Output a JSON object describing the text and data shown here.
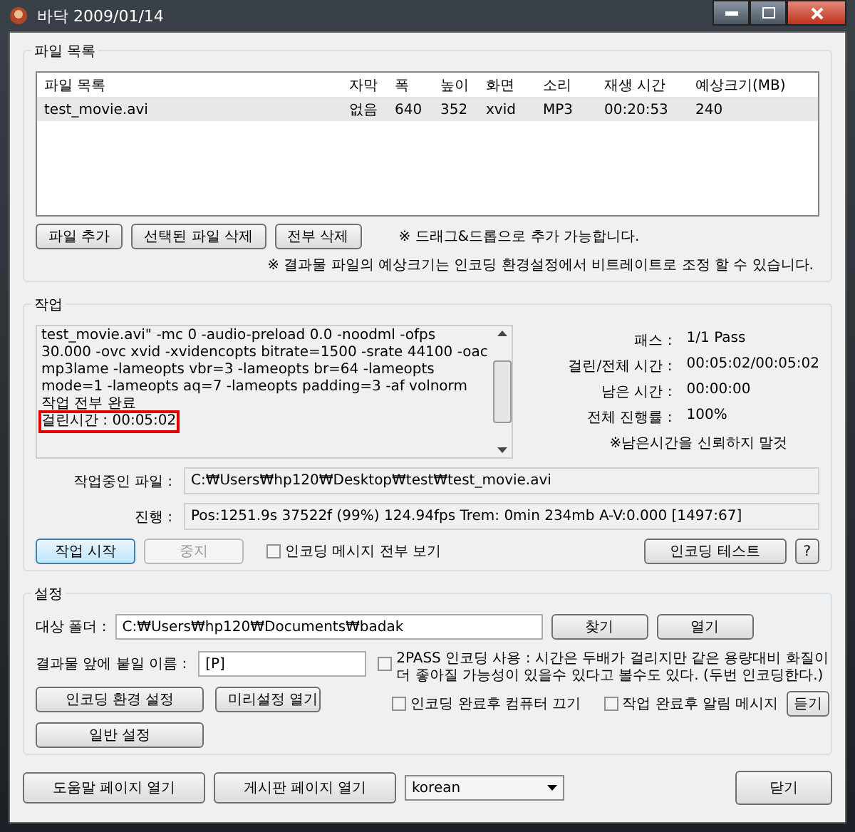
{
  "window": {
    "title": "바닥 2009/01/14"
  },
  "file_list": {
    "title": "파일 목록",
    "columns": [
      "파일 목록",
      "자막",
      "폭",
      "높이",
      "화면",
      "소리",
      "재생 시간",
      "예상크기(MB)"
    ],
    "rows": [
      {
        "selected": true,
        "cells": [
          "test_movie.avi",
          "없음",
          "640",
          "352",
          "xvid",
          "MP3",
          "00:20:53",
          "240"
        ]
      }
    ],
    "buttons": [
      {
        "label": "파일 추가",
        "disabled": false
      },
      {
        "label": "선택된 파일 삭제",
        "disabled": false
      },
      {
        "label": "전부 삭제",
        "disabled": false
      }
    ],
    "notes": [
      "※ 드래그&드롭으로 추가 가능합니다.",
      "※ 결과물 파일의 예상크기는 인코딩 환경설정에서 비트레이트로 조정 할 수 있습니다."
    ]
  },
  "job": {
    "title": "작업",
    "log": [
      {
        "text": "test_movie.avi\" -mc 0 -audio-preload 0.0 -noodml -ofps 30.000 -ovc xvid -xvidencopts bitrate=1500 -srate 44100 -oac mp3lame -lameopts vbr=3  -lameopts br=64 -lameopts mode=1 -lameopts aq=7 -lameopts padding=3 -af volnorm",
        "highlighted": false
      },
      {
        "text": "작업 전부 완료",
        "highlighted": false
      },
      {
        "text": "걸린시간 : 00:05:02",
        "highlighted": true
      }
    ],
    "stats": [
      {
        "label": "패스 :",
        "value": "1/1 Pass"
      },
      {
        "label": "걸린/전체 시간 :",
        "value": "00:05:02/00:05:02"
      },
      {
        "label": "남은 시간 :",
        "value": "00:00:00"
      },
      {
        "label": "전체 진행률 :",
        "value": "100%"
      }
    ],
    "stats_note": "※남은시간을 신뢰하지 말것",
    "current_file": {
      "label": "작업중인 파일 :",
      "value": "C:₩Users₩hp120₩Desktop₩test₩test_movie.avi"
    },
    "progress": {
      "label": "진행 :",
      "value": "Pos:1251.9s  37522f (99%) 124.94fps Trem:   0min 234mb  A-V:0.000 [1497:67]"
    },
    "buttons": [
      {
        "label": "작업 시작",
        "disabled": false,
        "focused": true
      },
      {
        "label": "중지",
        "disabled": true,
        "focused": false
      }
    ],
    "show_all_messages": {
      "label": "인코딩 메시지 전부 보기",
      "checked": false
    },
    "test_buttons": [
      {
        "label": "인코딩 테스트",
        "disabled": false
      },
      {
        "label": "?",
        "disabled": false
      }
    ]
  },
  "settings": {
    "title": "설정",
    "target_folder": {
      "label": "대상 폴더 :",
      "value": "C:₩Users₩hp120₩Documents₩badak"
    },
    "folder_buttons": [
      {
        "label": "찾기"
      },
      {
        "label": "열기"
      }
    ],
    "prefix": {
      "label": "결과물 앞에 붙일 이름 :",
      "value": "[P]"
    },
    "two_pass": {
      "label": "2PASS 인코딩 사용 : 시간은 두배가 걸리지만 같은 용량대비 화질이 더 좋아질 가능성이 있을수 있다고 볼수도 있다. (두번 인코딩한다.)",
      "checked": false
    },
    "buttons": [
      {
        "label": "인코딩 환경 설정"
      },
      {
        "label": "미리설정 열기"
      },
      {
        "label": "일반 설정"
      }
    ],
    "shutdown": {
      "label": "인코딩 완료후 컴퓨터 끄기",
      "checked": false
    },
    "notify": {
      "label": "작업 완료후 알림 메시지",
      "checked": false
    },
    "listen_button": "듣기"
  },
  "footer": {
    "buttons": [
      "도움말 페이지 열기",
      "게시판 페이지 열기"
    ],
    "language": "korean",
    "close_button": "닫기"
  }
}
